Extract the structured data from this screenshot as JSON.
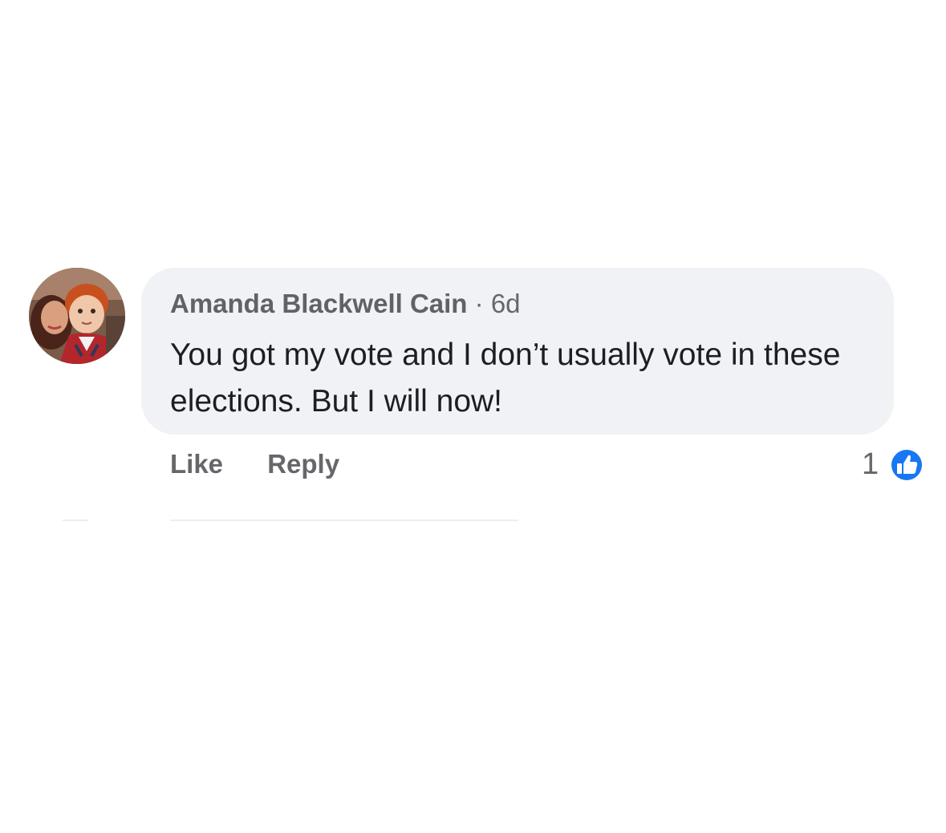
{
  "comment": {
    "author": "Amanda Blackwell Cain",
    "separator": "·",
    "time": "6d",
    "text": "You got my vote and I don’t usually vote in these elections.  But I will now!",
    "actions": {
      "like_label": "Like",
      "reply_label": "Reply"
    },
    "reactions": {
      "count": "1",
      "icon": "like-icon",
      "color": "#1877f2"
    }
  },
  "colors": {
    "bubble": "#f0f2f5",
    "meta_text": "#65676b",
    "body_text": "#1c1e21",
    "like_blue": "#1877f2"
  }
}
